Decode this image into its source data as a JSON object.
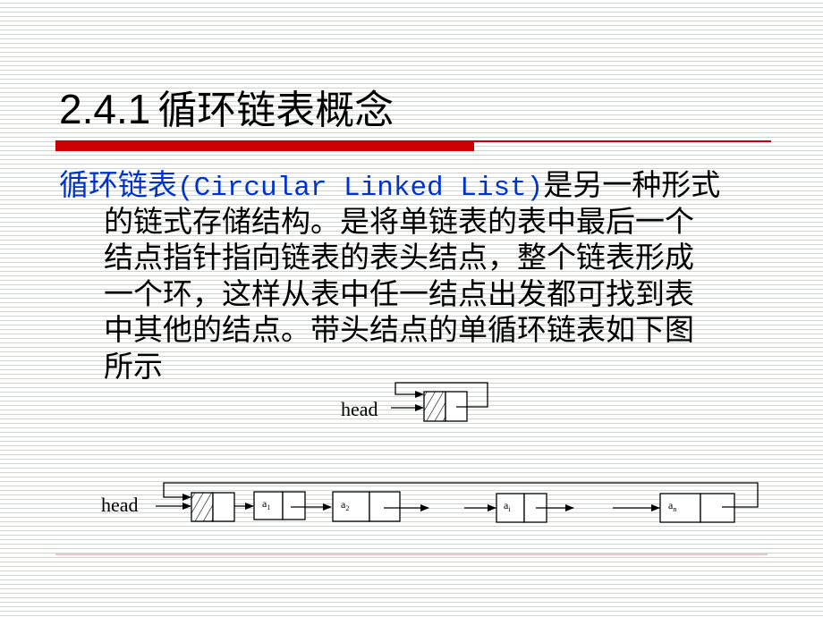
{
  "slide": {
    "title_number": "2.4.1",
    "title_text": "循环链表概念",
    "accent_color": "#cc0000",
    "highlight_color": "#0033cc"
  },
  "paragraph": {
    "term": "循环链表",
    "term_en": "(Circular Linked List)",
    "lines": [
      "是另一种形式",
      "的链式存储结构。是将单链表的表中最后一个",
      "结点指针指向链表的表头结点，整个链表形成",
      "一个环，这样从表中任一结点出发都可找到表",
      "中其他的结点。带头结点的单循环链表如下图",
      "所示"
    ]
  },
  "diagram_empty": {
    "pointer_label": "head"
  },
  "diagram_full": {
    "pointer_label": "head",
    "nodes": [
      {
        "label": "a",
        "sub": "1"
      },
      {
        "label": "a",
        "sub": "2"
      },
      {
        "label": "a",
        "sub": "i"
      },
      {
        "label": "a",
        "sub": "n"
      }
    ]
  }
}
